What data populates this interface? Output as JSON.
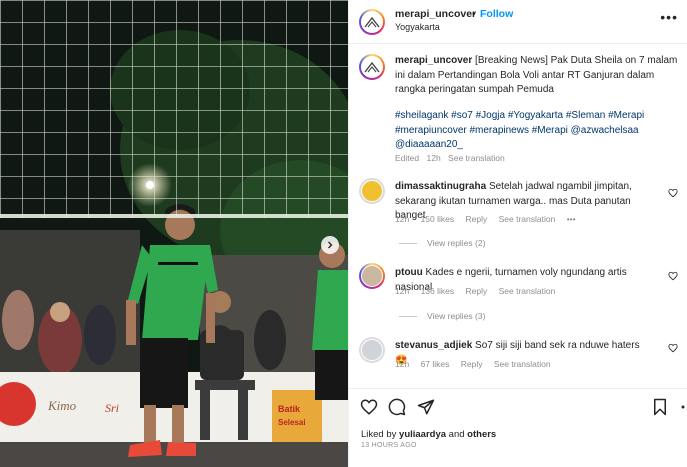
{
  "post": {
    "username": "merapi_uncover",
    "dot": "•",
    "follow_label": "Follow",
    "location": "Yogyakarta",
    "more_label": "•••",
    "caption_text": "[Breaking News] Pak Duta Sheila on 7 malam ini dalam Pertandingan Bola Voli antar RT Ganjuran dalam rangka peringatan sumpah Pemuda",
    "hashtags": "#sheilagank #so7 #Jogja #Yogyakarta #Sleman #Merapi #merapiuncover #merapinews #Merapi @azwachelsaa @diaaaaan20_",
    "edited": "Edited",
    "time": "12h",
    "see_translation": "See translation"
  },
  "media": {
    "banner_text_1": "Kimo",
    "banner_text_2": "Sri",
    "banner_text_3": "Batik",
    "banner_text_4": "Selesai"
  },
  "comments": [
    {
      "username": "dimassaktinugraha",
      "text": "Setelah jadwal ngambil jimpitan, sekarang ikutan turnamen warga.. mas Duta panutan banget",
      "time": "12h",
      "likes": "150 likes",
      "reply": "Reply",
      "see_translation": "See translation",
      "more": "•••",
      "view_replies": "View replies (2)"
    },
    {
      "username": "ptouu",
      "text": "Kades e ngerii, turnamen voly ngundang artis nasional",
      "time": "12h",
      "likes": "136 likes",
      "reply": "Reply",
      "see_translation": "See translation",
      "view_replies": "View replies (3)"
    },
    {
      "username": "stevanus_adjiek",
      "text": "So7 siji siji band sek ra nduwe haters",
      "emoji": "😍",
      "time": "12h",
      "likes": "67 likes",
      "reply": "Reply",
      "see_translation": "See translation"
    }
  ],
  "footer": {
    "liked_by_prefix": "Liked by",
    "liked_by_user": "yuliaardya",
    "liked_by_suffix": "and",
    "liked_by_others": "others",
    "posted_ago": "13 HOURS AGO"
  },
  "colors": {
    "link": "#0095f6",
    "hashtag": "#00376b",
    "muted": "#8e8e8e",
    "jersey": "#2fa84f"
  },
  "icons": [
    "heart-icon",
    "comment-icon",
    "share-icon",
    "bookmark-icon",
    "more-icon",
    "chevron-right-icon"
  ]
}
